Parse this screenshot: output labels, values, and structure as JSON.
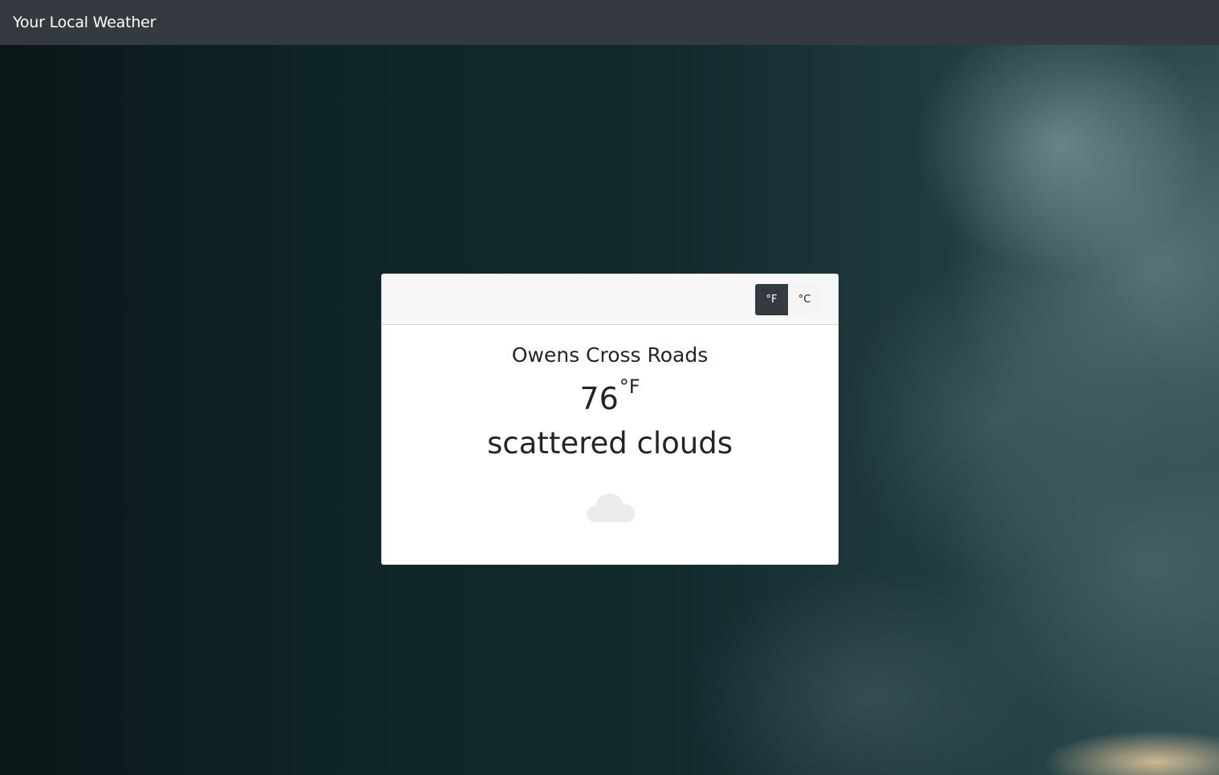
{
  "navbar": {
    "brand": "Your Local Weather"
  },
  "card": {
    "unit_toggle": {
      "fahrenheit_label": "°F",
      "celsius_label": "°C",
      "selected": "°F"
    },
    "city": "Owens Cross Roads",
    "temperature": "76",
    "temperature_unit": "°F",
    "description": "scattered clouds",
    "icon": "cloud-icon"
  },
  "colors": {
    "navbar_bg": "#343a40",
    "active_button_bg": "#343a40",
    "card_header_bg": "#f7f7f7",
    "text": "#212529",
    "icon_color": "#ececec"
  }
}
